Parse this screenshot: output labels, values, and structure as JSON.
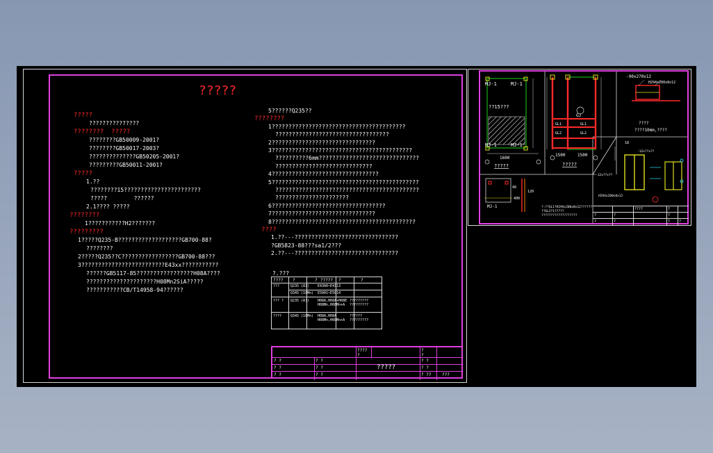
{
  "drawing": {
    "title": "?????",
    "left_notes": [
      {
        "t": "?????",
        "red": true
      },
      {
        "t": "???????????????",
        "red": false
      },
      {
        "t": "????????  ?????",
        "red": true
      },
      {
        "t": "????????GB50009-2001?",
        "red": false
      },
      {
        "t": "????????GB50017-2003?",
        "red": false
      },
      {
        "t": "??????????????GB50205-2001?",
        "red": false
      },
      {
        "t": "?????????GB50011-2001?",
        "red": false
      },
      {
        "t": "?????",
        "red": true
      },
      {
        "t": "1.??",
        "red": false
      },
      {
        "t": "????????15???????????????????????",
        "red": false
      },
      {
        "t": "?????        ??????",
        "red": false
      },
      {
        "t": "2.1???? ?????",
        "red": false
      },
      {
        "t": "????????",
        "red": true
      },
      {
        "t": "1???????????H2???????",
        "red": false
      },
      {
        "t": "?????????",
        "red": true
      },
      {
        "t": "1?????Q235-B???????????????????GB700-88?",
        "red": false
      },
      {
        "t": "????????",
        "red": false
      },
      {
        "t": "2?????Q235??C?????????????????GB700-88???",
        "red": false
      },
      {
        "t": "3?????????????????????????E43xx???????????",
        "red": false
      },
      {
        "t": "??????GB5117-85?????????????????H08A????",
        "red": false
      },
      {
        "t": "?????????????????????H08Mn2SiA?????",
        "red": false
      },
      {
        "t": "???????????CB/T14958-94??????",
        "red": false
      }
    ],
    "right_notes": [
      {
        "t": "5??????Q235??",
        "red": false
      },
      {
        "t": "????????",
        "red": true
      },
      {
        "t": "1????????????????????????????????????????",
        "red": false
      },
      {
        "t": "??????????????????????????????????",
        "red": false
      },
      {
        "t": "2???????????????????????????????",
        "red": false
      },
      {
        "t": "3??????????????????????????????????????????",
        "red": false
      },
      {
        "t": "??????????6mm??????????????????????????????",
        "red": false
      },
      {
        "t": "?????????????????????????????",
        "red": false
      },
      {
        "t": "4????????????????????????????????",
        "red": false
      },
      {
        "t": "5????????????????????????????????????????????",
        "red": false
      },
      {
        "t": "???????????????????????????????????????????",
        "red": false
      },
      {
        "t": "??????????????????????",
        "red": false
      },
      {
        "t": "6??????????????????????????????????",
        "red": false
      },
      {
        "t": "7???????????????????????????????",
        "red": false
      },
      {
        "t": "8???????????????????????????????????????????",
        "red": false
      },
      {
        "t": "????",
        "red": true
      },
      {
        "t": "1.??---???????????????????????????????",
        "red": false
      },
      {
        "t": "?GB5823-88???sa1/2???",
        "red": false
      },
      {
        "t": "2.??---???????????????????????????????",
        "red": false
      }
    ],
    "steel_table": {
      "caption": "?.???",
      "header": [
        "????",
        "?",
        "?",
        "?????",
        "?",
        "?"
      ],
      "rows": [
        [
          "???",
          "Q235 (A3)",
          "E4300~E4313",
          "",
          ""
        ],
        [
          "",
          "Q345 (16Mn)",
          "E5001~E5014",
          "",
          ""
        ],
        [
          "??? ?",
          "Q235 (A3)",
          "H08A,H08A+H08E\nH08Mn,H08Mn+A",
          "?????????\n?????????"
        ],
        [
          "????",
          "Q345 (16Mn)",
          "H08A,H08A\nH08Mn,H08Mn+A",
          "??????\n?????????"
        ]
      ]
    },
    "title_block": {
      "row1": [
        "????",
        "?",
        "?",
        "?"
      ],
      "cells": [
        "? ?",
        "? ?",
        "? ?",
        "? ?",
        "? ?",
        "? ?",
        "? ?",
        "? ?",
        "? ??",
        "???"
      ],
      "drawing_name": "?????"
    }
  },
  "detail_sheet": {
    "labels": {
      "mj1": "MJ-1",
      "col_note": "??15???",
      "gj": "GJ",
      "dim_bottom_left": "1600",
      "dims_mid": [
        "1500",
        "1500"
      ],
      "gl_labels": [
        "GL1",
        "GL2",
        "GL3",
        "GL4",
        "GL1",
        "GL2",
        "GL3",
        "GL4"
      ],
      "plate": "-90x270x12",
      "plate2": "H294x200x8x12",
      "note_wave": "????",
      "note_mm": "????10mm,????",
      "label_18": "18",
      "section_labels": [
        "-12x??x??",
        "H294x200x8x12",
        "-12x??x??"
      ],
      "mj1_small": "MJ-1",
      "dims_small": [
        "40",
        "400",
        "120"
      ],
      "footnote1": "?:??GL1?H294x200x8x12??????",
      "footnote2": "??GL2?1?????",
      "footnote3": "???????????????????",
      "underline1": "?????",
      "underline2": "?????"
    },
    "title_block": [
      "????",
      "?",
      "?",
      "?",
      "?",
      "?",
      "?",
      "?",
      "?"
    ]
  },
  "colors": {
    "background": "#000000",
    "frame_border": "#e040e0",
    "line": "#d8d8d8",
    "red_text": "#ff2a2a",
    "green": "#20d020",
    "yellow": "#e0e020",
    "cyan": "#20c8e0",
    "orange": "#ff8000"
  }
}
